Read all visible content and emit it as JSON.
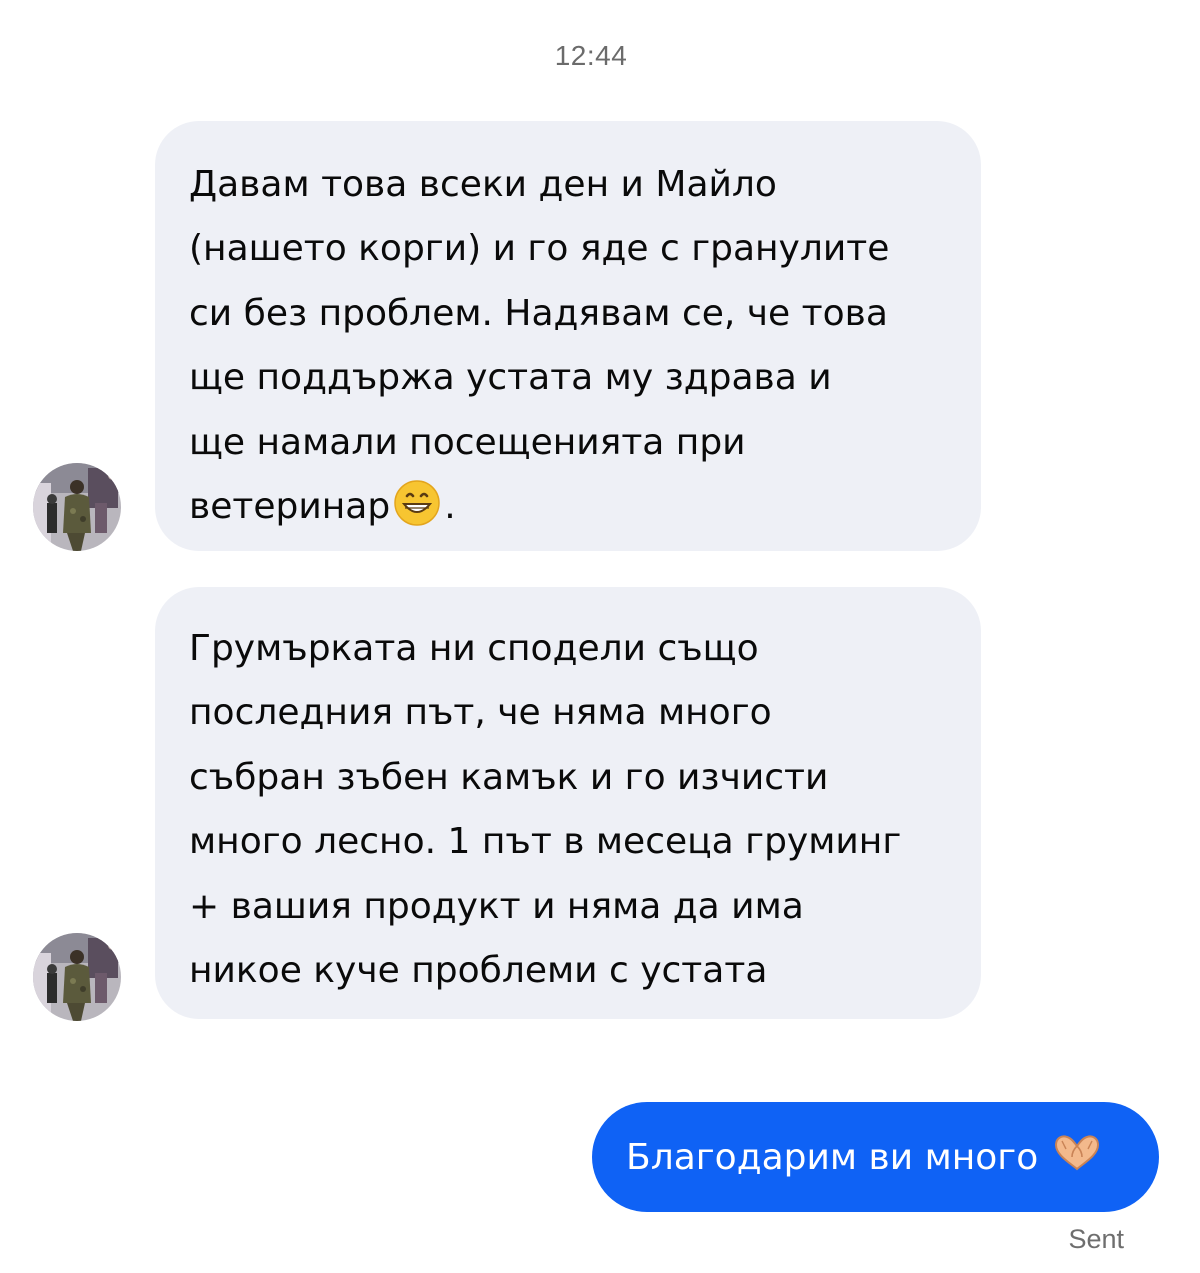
{
  "thread": {
    "timestamp": "12:44",
    "sent_status": "Sent"
  },
  "messages": [
    {
      "direction": "incoming",
      "lines": [
        "Давам това всеки ден и Майло",
        "(нашето корги) и го яде с гранулите",
        "си без проблем. Надявам се, че това",
        "ще поддържа устата му здрава и",
        "ще намали посещенията при",
        "ветеринар"
      ],
      "trailing_emoji": "grinning-face-icon",
      "trailing_text": "."
    },
    {
      "direction": "incoming",
      "lines": [
        "Грумърката ни сподели също",
        "последния път, че няма много",
        "събран зъбен камък и го изчисти",
        "много лесно. 1 път в месеца груминг",
        "+ вашия продукт и няма да има",
        "никое куче проблеми с устата"
      ]
    },
    {
      "direction": "outgoing",
      "text": "Благодарим ви много",
      "trailing_emoji": "heart-hands-icon"
    }
  ],
  "colors": {
    "incoming_bubble": "#eef0f6",
    "outgoing_bubble": "#0f62f5",
    "timestamp": "#6b6b6b"
  }
}
